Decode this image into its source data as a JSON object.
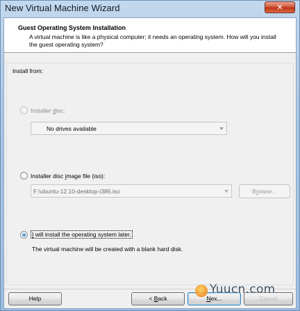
{
  "window": {
    "title": "New Virtual Machine Wizard",
    "close_glyph": "✕"
  },
  "header": {
    "title": "Guest Operating System Installation",
    "description": "A virtual machine is like a physical computer; it needs an operating system. How will you install the guest operating system?"
  },
  "install_from": {
    "label": "Install from:",
    "installer_disc": {
      "label_pre": "Installer ",
      "label_key": "d",
      "label_post": "isc:",
      "selected": false,
      "enabled": false,
      "drive_value": "No drives available"
    },
    "disc_image": {
      "label_pre": "Installer disc ",
      "label_key": "i",
      "label_post": "mage file (iso):",
      "selected": false,
      "enabled": true,
      "path_value": "F:\\ubuntu-12.10-desktop-i386.iso",
      "browse_pre": "B",
      "browse_key": "r",
      "browse_post": "owse..."
    },
    "install_later": {
      "label_key": "I",
      "label_post": " will install the operating system later.",
      "selected": true,
      "description": "The virtual machine will be created with a blank hard disk."
    }
  },
  "footer": {
    "help_label": "Help",
    "back_pre": "< ",
    "back_key": "B",
    "back_post": "ack",
    "next_pre": "",
    "next_key": "N",
    "next_post": "ex...",
    "cancel_label": "Cancel"
  },
  "watermark": {
    "text": "Yuucn.com"
  },
  "colors": {
    "titlebar": "#a9c6e3",
    "close_button": "#c7402a",
    "selected_radio": "#2f7fc6"
  }
}
